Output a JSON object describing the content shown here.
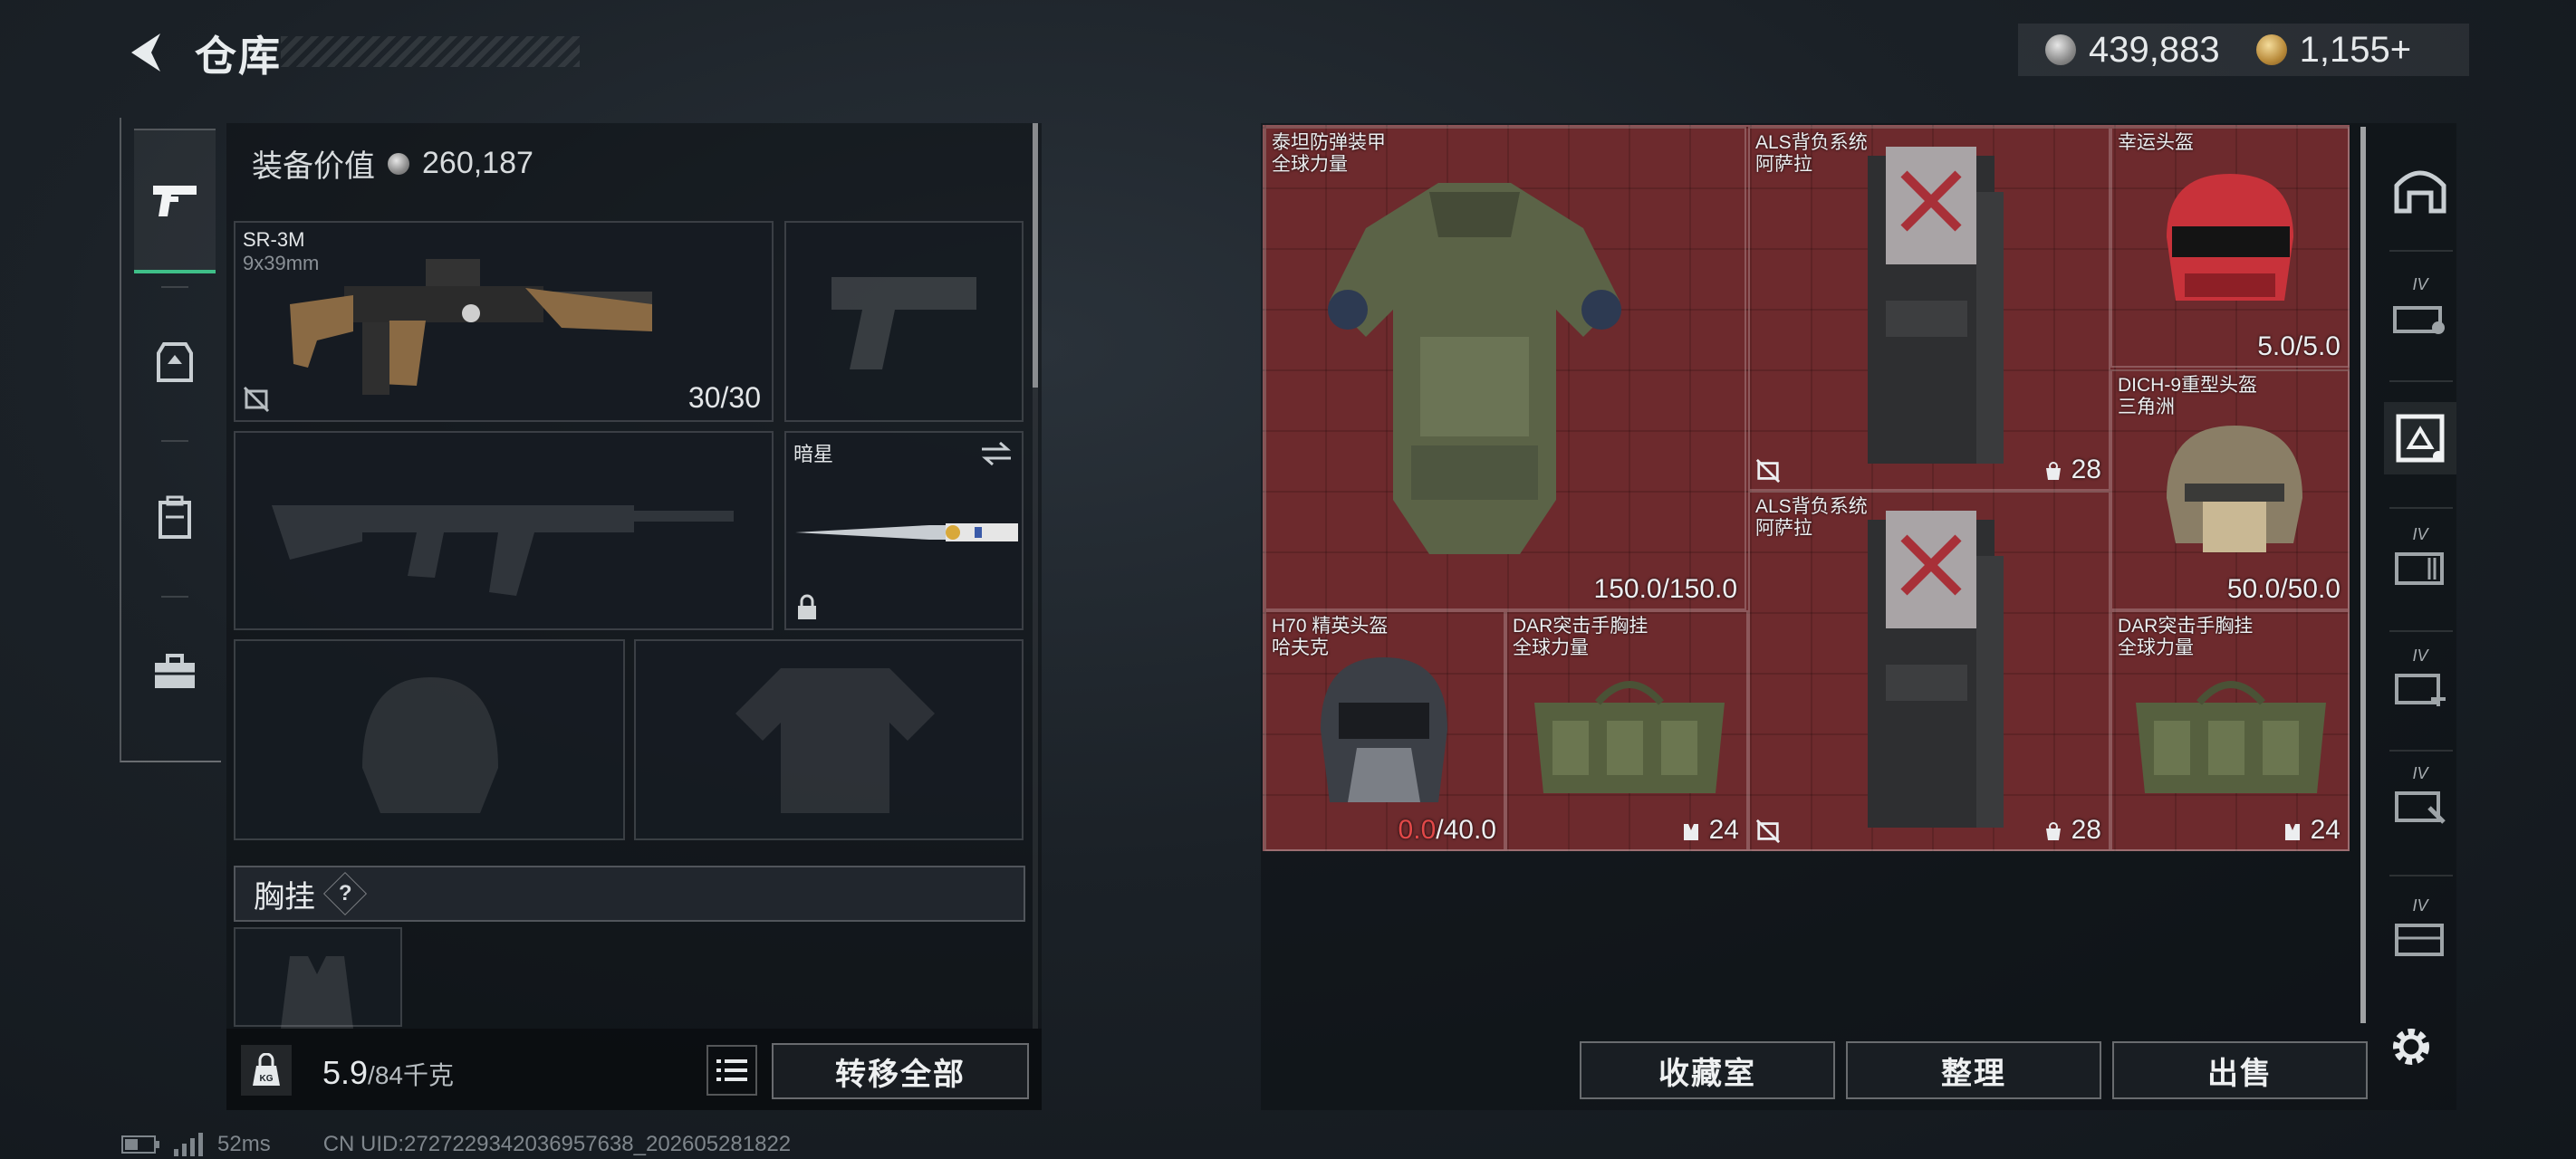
{
  "header": {
    "title": "仓库"
  },
  "currency": {
    "silver": "439,883",
    "gold": "1,155+"
  },
  "equipment": {
    "value_label": "装备价值",
    "value": "260,187",
    "primary_weapon": {
      "name": "SR-3M",
      "caliber": "9x39mm",
      "ammo": "30/30"
    },
    "melee": {
      "name": "暗星"
    },
    "chest_rig_section": {
      "title": "胸挂",
      "help": "?"
    }
  },
  "weight": {
    "value": "5.9",
    "capacity": "/84千克"
  },
  "buttons": {
    "transfer_all": "转移全部",
    "collection": "收藏室",
    "organize": "整理",
    "sell": "出售"
  },
  "storage_items": [
    {
      "name": "泰坦防弹装甲",
      "sub": "全球力量",
      "value": "150.0/150.0"
    },
    {
      "name": "ALS背负系统",
      "sub": "阿萨拉",
      "value": "28"
    },
    {
      "name": "幸运头盔",
      "sub": "",
      "value": "5.0/5.0"
    },
    {
      "name": "DICH-9重型头盔",
      "sub": "三角洲",
      "value": "50.0/50.0"
    },
    {
      "name": "ALS背负系统",
      "sub": "阿萨拉",
      "value": "28"
    },
    {
      "name": "H70 精英头盔",
      "sub": "哈夫克",
      "value_current": "0.0",
      "value_max": "/40.0"
    },
    {
      "name": "DAR突击手胸挂",
      "sub": "全球力量",
      "value": "24"
    },
    {
      "name": "DAR突击手胸挂",
      "sub": "全球力量",
      "value": "24"
    }
  ],
  "right_nav": {
    "tiers": [
      "IV",
      "IV",
      "IV",
      "IV",
      "IV"
    ]
  },
  "footer": {
    "ping": "52ms",
    "uid": "CN UID:272722934203695763​8_202605281822"
  },
  "colors": {
    "grid_red": "#6e2a2d",
    "accent_green": "#3fbf88",
    "damage_red": "#e24848"
  }
}
